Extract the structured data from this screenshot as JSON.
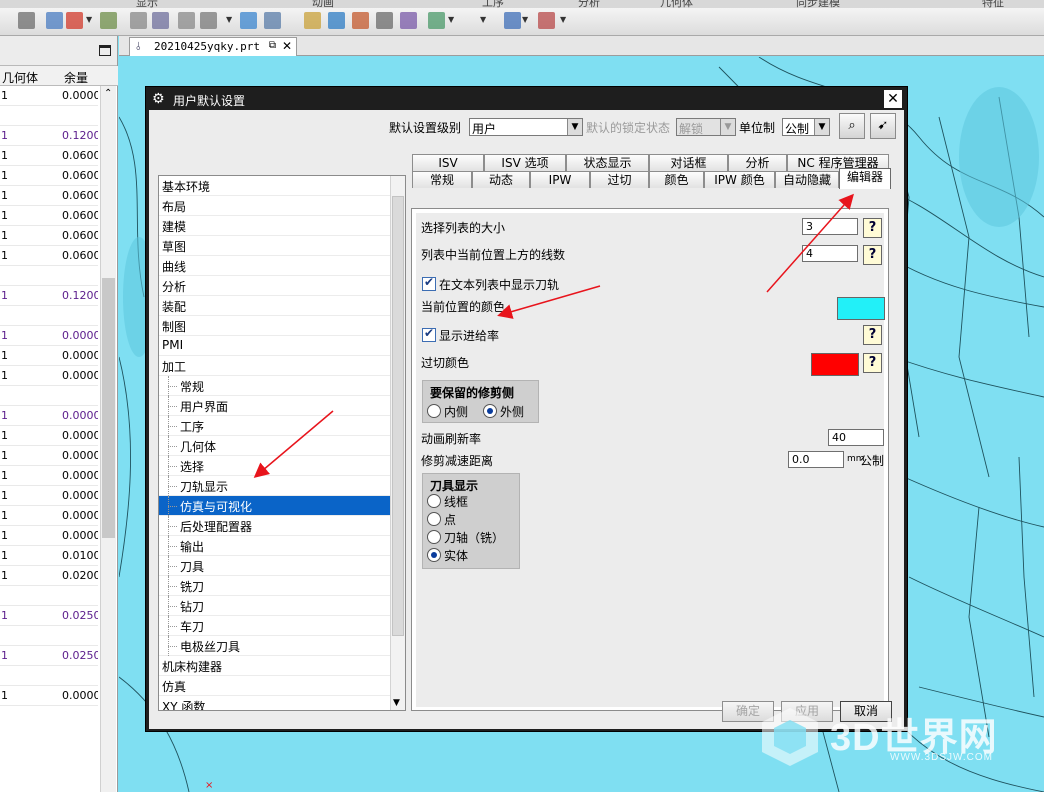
{
  "menu": [
    "显示",
    "动画",
    "工序",
    "分析",
    "几何体",
    "同步建模",
    "特征"
  ],
  "toolbar_icons": [
    "filter-icon",
    "move-icon",
    "add-icon",
    "dimension-icon",
    "snap-icon",
    "select-icon",
    "box-icon",
    "cloud-icon",
    "cube-icon",
    "fit-icon",
    "zoom-icon",
    "rotate-icon",
    "paint-icon",
    "layer-icon",
    "view-icon",
    "render-icon",
    "display-icon",
    "orient-icon"
  ],
  "navigator": {
    "columns": [
      "几何体",
      "余量"
    ],
    "rows": [
      {
        "c1": "1",
        "c2": "0.0000",
        "purple": false
      },
      {
        "c1": "",
        "c2": "",
        "purple": false
      },
      {
        "c1": "1",
        "c2": "0.1200",
        "purple": true
      },
      {
        "c1": "1",
        "c2": "0.0600",
        "purple": false
      },
      {
        "c1": "1",
        "c2": "0.0600",
        "purple": false
      },
      {
        "c1": "1",
        "c2": "0.0600",
        "purple": false
      },
      {
        "c1": "1",
        "c2": "0.0600",
        "purple": false
      },
      {
        "c1": "1",
        "c2": "0.0600",
        "purple": false
      },
      {
        "c1": "1",
        "c2": "0.0600",
        "purple": false
      },
      {
        "c1": "",
        "c2": "",
        "purple": false
      },
      {
        "c1": "1",
        "c2": "0.1200",
        "purple": true
      },
      {
        "c1": "",
        "c2": "",
        "purple": false
      },
      {
        "c1": "1",
        "c2": "0.0000",
        "purple": true
      },
      {
        "c1": "1",
        "c2": "0.0000",
        "purple": false
      },
      {
        "c1": "1",
        "c2": "0.0000",
        "purple": false
      },
      {
        "c1": "",
        "c2": "",
        "purple": false
      },
      {
        "c1": "1",
        "c2": "0.0000",
        "purple": true
      },
      {
        "c1": "1",
        "c2": "0.0000",
        "purple": false
      },
      {
        "c1": "1",
        "c2": "0.0000",
        "purple": false
      },
      {
        "c1": "1",
        "c2": "0.0000",
        "purple": false
      },
      {
        "c1": "1",
        "c2": "0.0000",
        "purple": false
      },
      {
        "c1": "1",
        "c2": "0.0000",
        "purple": false
      },
      {
        "c1": "1",
        "c2": "0.0000",
        "purple": false
      },
      {
        "c1": "1",
        "c2": "0.0100",
        "purple": false
      },
      {
        "c1": "1",
        "c2": "0.0200",
        "purple": false
      },
      {
        "c1": "",
        "c2": "",
        "purple": false
      },
      {
        "c1": "1",
        "c2": "0.0250",
        "purple": true
      },
      {
        "c1": "",
        "c2": "",
        "purple": false
      },
      {
        "c1": "1",
        "c2": "0.0250",
        "purple": true
      },
      {
        "c1": "",
        "c2": "",
        "purple": false
      },
      {
        "c1": "1",
        "c2": "0.0000",
        "purple": false
      }
    ]
  },
  "file_tab": {
    "name": "20210425yqky.prt",
    "close": "✕",
    "min": "⧉"
  },
  "dialog": {
    "title": "用户默认设置",
    "close": "✕",
    "level_label": "默认设置级别",
    "level_value": "用户",
    "locked_label": "默认的锁定状态",
    "locked_value": "解锁",
    "unit_label": "单位制",
    "unit_value": "公制",
    "tree": [
      {
        "label": "基本环境",
        "level": 0
      },
      {
        "label": "布局",
        "level": 0
      },
      {
        "label": "建模",
        "level": 0
      },
      {
        "label": "草图",
        "level": 0
      },
      {
        "label": "曲线",
        "level": 0
      },
      {
        "label": "分析",
        "level": 0
      },
      {
        "label": "装配",
        "level": 0
      },
      {
        "label": "制图",
        "level": 0
      },
      {
        "label": "PMI",
        "level": 0
      },
      {
        "label": "加工",
        "level": 0
      },
      {
        "label": "常规",
        "level": 1
      },
      {
        "label": "用户界面",
        "level": 1
      },
      {
        "label": "工序",
        "level": 1
      },
      {
        "label": "几何体",
        "level": 1
      },
      {
        "label": "选择",
        "level": 1
      },
      {
        "label": "刀轨显示",
        "level": 1
      },
      {
        "label": "仿真与可视化",
        "level": 1,
        "selected": true
      },
      {
        "label": "后处理配置器",
        "level": 1
      },
      {
        "label": "输出",
        "level": 1
      },
      {
        "label": "刀具",
        "level": 1
      },
      {
        "label": "铣刀",
        "level": 1
      },
      {
        "label": "钻刀",
        "level": 1
      },
      {
        "label": "车刀",
        "level": 1
      },
      {
        "label": "电极丝刀具",
        "level": 1
      },
      {
        "label": "机床构建器",
        "level": 0
      },
      {
        "label": "仿真",
        "level": 0
      },
      {
        "label": "XY 函数",
        "level": 0
      }
    ],
    "tabs_row1": [
      "ISV",
      "ISV 选项",
      "状态显示",
      "对话框",
      "分析",
      "NC 程序管理器"
    ],
    "tabs_row2": [
      "常规",
      "动态",
      "IPW",
      "过切",
      "颜色",
      "IPW 颜色",
      "自动隐藏",
      "编辑器"
    ],
    "active_tab": "编辑器",
    "editor": {
      "list_size_label": "选择列表的大小",
      "list_size_value": "3",
      "lines_above_label": "列表中当前位置上方的线数",
      "lines_above_value": "4",
      "show_toolpath_label": "在文本列表中显示刀轨",
      "current_color_label": "当前位置的颜色",
      "current_color": "#22f0f8",
      "show_feed_label": "显示进给率",
      "gouge_color_label": "过切颜色",
      "gouge_color": "#ff0000",
      "trim_side_title": "要保留的修剪侧",
      "trim_inside": "内侧",
      "trim_outside": "外侧",
      "refresh_label": "动画刷新率",
      "refresh_value": "40",
      "trim_decel_label": "修剪减速距离",
      "trim_decel_value": "0.0",
      "trim_decel_unit": "mm",
      "trim_decel_system": "公制",
      "tool_display_title": "刀具显示",
      "tool_options": [
        "线框",
        "点",
        "刀轴（铣）",
        "实体"
      ],
      "tool_selected": "实体"
    },
    "buttons": {
      "ok": "确定",
      "apply": "应用",
      "cancel": "取消"
    }
  },
  "watermark": {
    "main": "3D世界网",
    "sub": "WWW.3DSJW.COM"
  },
  "colors": {
    "background": "#7fdff2",
    "selection": "#0a64c8",
    "arrow": "#e8141c"
  }
}
